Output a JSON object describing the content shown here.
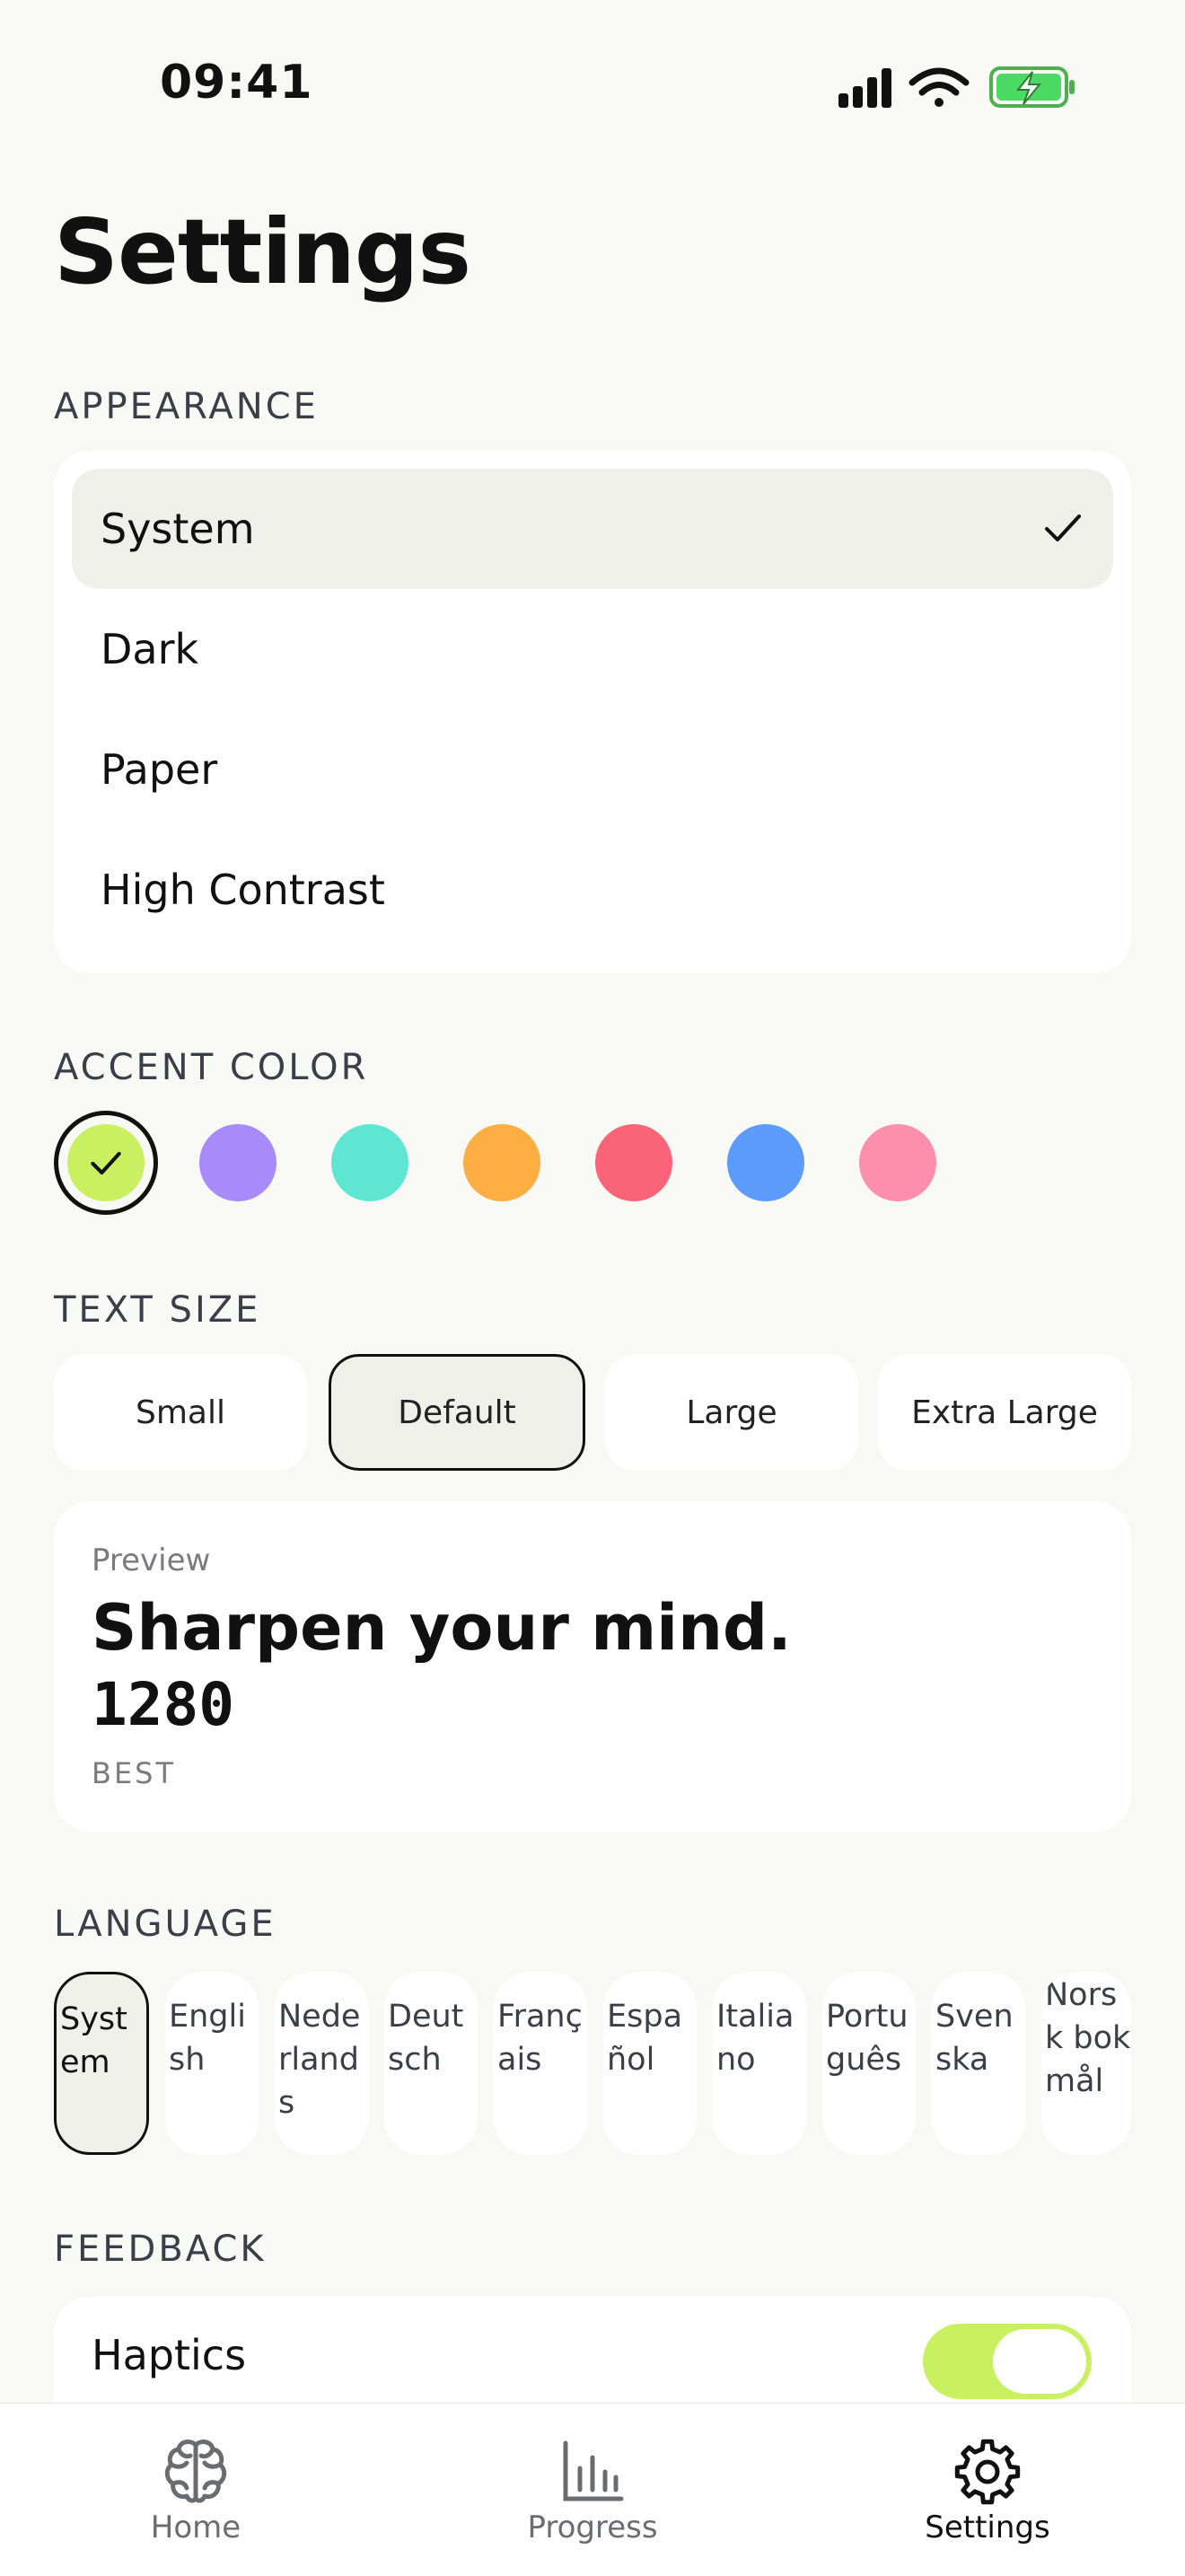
{
  "status_bar": {
    "time": "09:41"
  },
  "title": "Settings",
  "appearance": {
    "label": "APPEARANCE",
    "options": [
      "System",
      "Dark",
      "Paper",
      "High Contrast"
    ],
    "selected": "System"
  },
  "accent": {
    "label": "ACCENT COLOR",
    "colors": [
      "#c8f060",
      "#a78bfa",
      "#5ee6d3",
      "#fdae42",
      "#fb6478",
      "#5b9bfb",
      "#fc8fae"
    ],
    "selected": "#c8f060"
  },
  "text_size": {
    "label": "TEXT SIZE",
    "options": [
      "Small",
      "Default",
      "Large",
      "Extra Large"
    ],
    "selected": "Default"
  },
  "preview": {
    "label": "Preview",
    "headline": "Sharpen your mind.",
    "number": "1280",
    "sub": "BEST"
  },
  "language": {
    "label": "LANGUAGE",
    "options": [
      "System",
      "English",
      "Nederlands",
      "Deutsch",
      "Français",
      "Español",
      "Italiano",
      "Português",
      "Svenska",
      "Norsk bokmål"
    ],
    "selected": "System"
  },
  "feedback": {
    "label": "FEEDBACK",
    "haptics_label": "Haptics",
    "haptics_on": true
  },
  "tabbar": {
    "tabs": [
      {
        "label": "Home",
        "icon": "brain-icon"
      },
      {
        "label": "Progress",
        "icon": "bar-chart-icon"
      },
      {
        "label": "Settings",
        "icon": "gear-icon"
      }
    ],
    "active": "Settings"
  }
}
